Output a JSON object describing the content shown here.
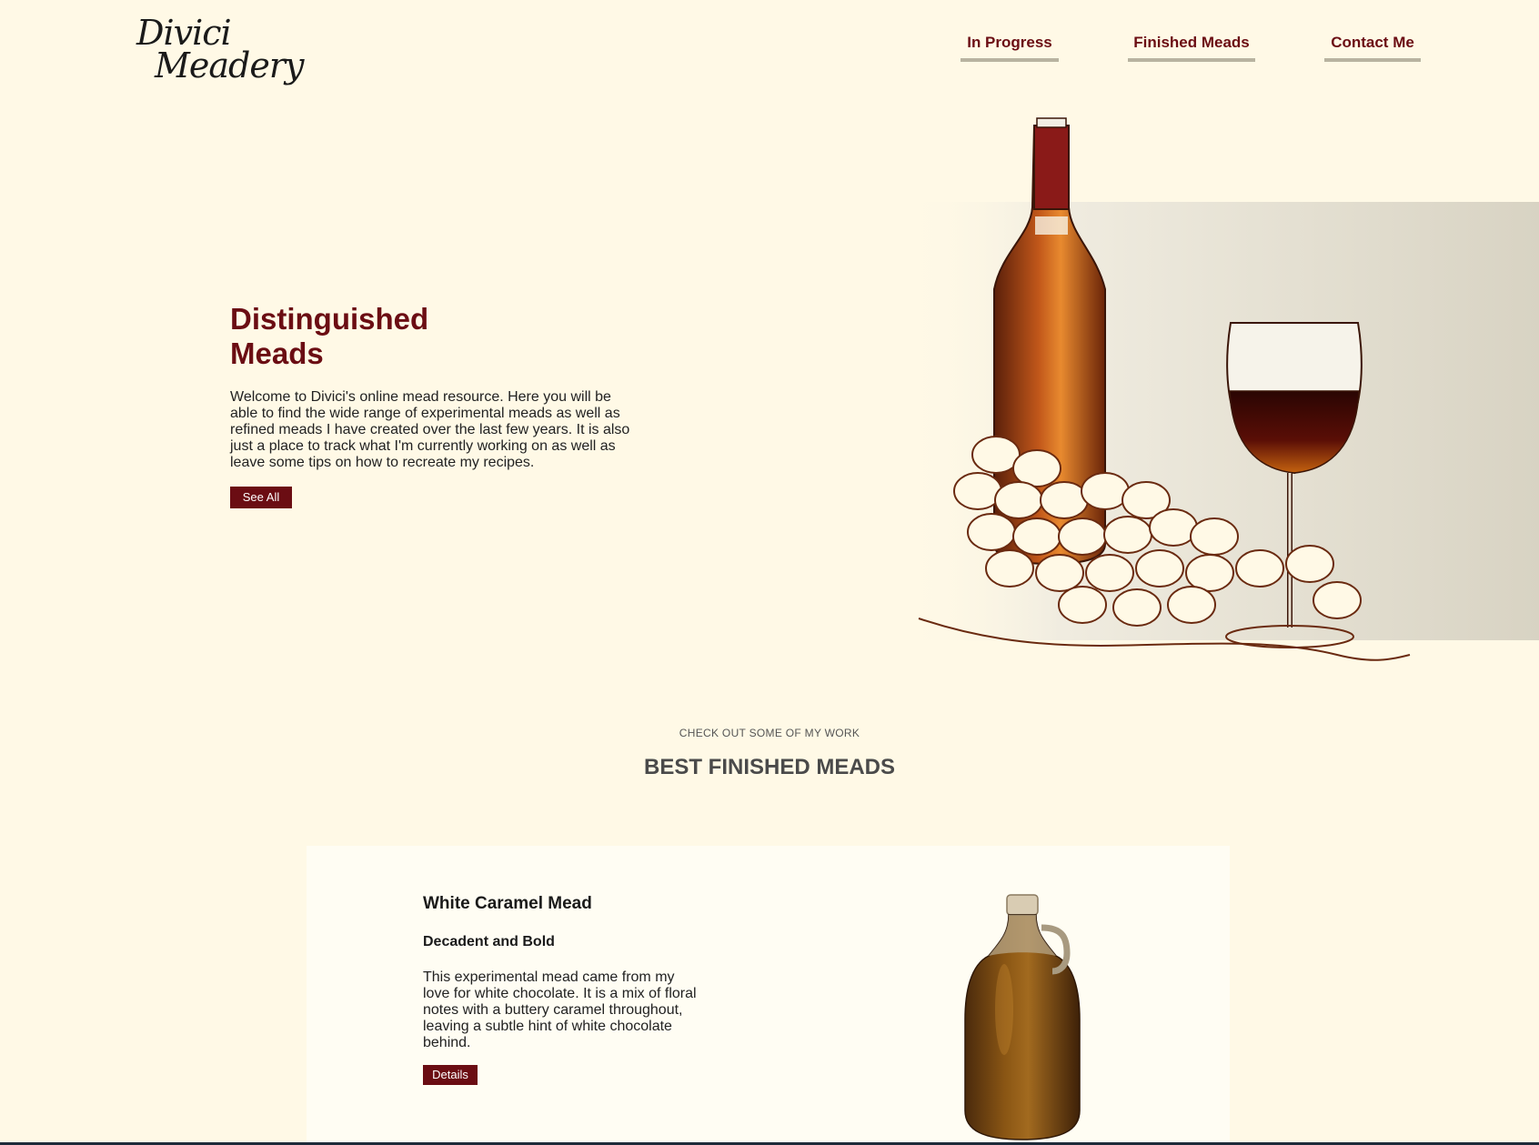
{
  "brand": {
    "logo_line1": "Divici",
    "logo_line2": "Meadery"
  },
  "nav": {
    "items": [
      {
        "label": "In Progress"
      },
      {
        "label": "Finished Meads"
      },
      {
        "label": "Contact Me"
      }
    ]
  },
  "hero": {
    "title_line1": "Distinguished",
    "title_line2": "Meads",
    "text": "Welcome to Divici's online mead resource. Here you will be able to find the wide range of experimental meads as well as refined meads I have created over the last few years. It is also just a place to track what I'm currently working on as well as leave some tips on how to recreate my recipes.",
    "button_label": "See All"
  },
  "section": {
    "eyebrow": "CHECK OUT SOME OF MY WORK",
    "title": "BEST FINISHED MEADS"
  },
  "card": {
    "title": "White Caramel Mead",
    "subtitle": "Decadent and Bold",
    "text": "This experimental mead came from my love for white chocolate. It is a mix of floral notes with a buttery caramel throughout, leaving a subtle hint of white chocolate behind.",
    "button_label": "Details"
  },
  "colors": {
    "background": "#fff9e6",
    "accent": "#6b0d13",
    "card_bg": "#fffdf3"
  },
  "icons": {
    "hero_image": "wine-bottle-glass-grapes-illustration",
    "card_image": "mead-jug"
  }
}
